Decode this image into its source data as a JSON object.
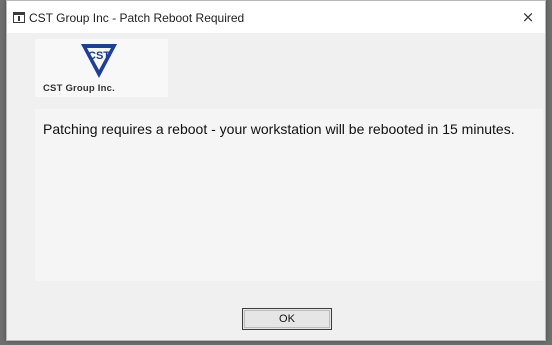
{
  "window": {
    "title": "CST Group Inc - Patch Reboot Required",
    "close_glyph": "×"
  },
  "logo": {
    "text": "CST Group Inc."
  },
  "message": {
    "text": "Patching requires a reboot - your workstation will be rebooted in 15 minutes."
  },
  "buttons": {
    "ok_label": "OK"
  },
  "colors": {
    "logo_primary": "#1d3f9a",
    "dialog_bg": "#f0f0f0",
    "titlebar_bg": "#ffffff"
  },
  "icons": {
    "app": "window-app-icon",
    "close": "close-icon",
    "logo": "cst-logo-triangle"
  }
}
